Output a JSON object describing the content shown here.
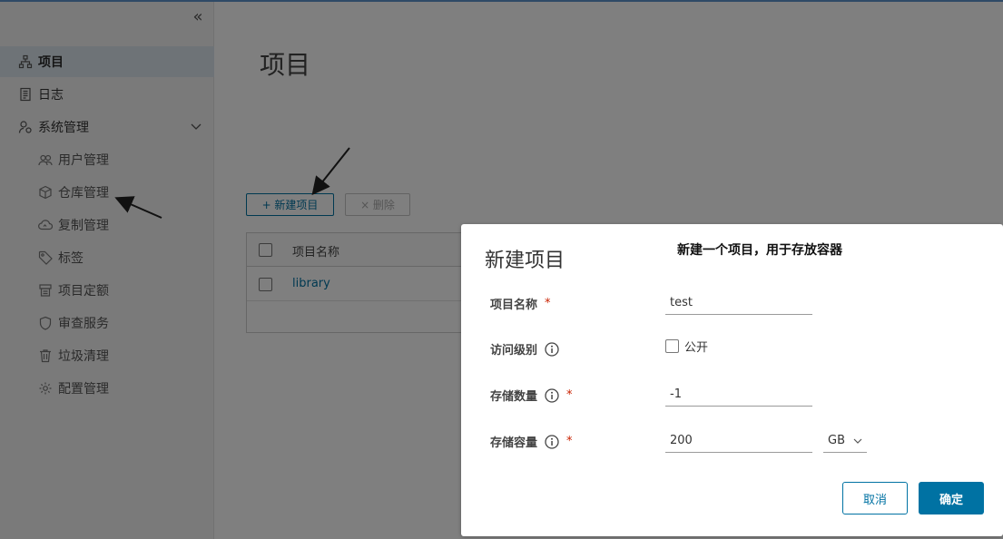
{
  "sidebar": {
    "items": [
      {
        "label": "项目",
        "icon": "projects-icon"
      },
      {
        "label": "日志",
        "icon": "logs-icon"
      },
      {
        "label": "系统管理",
        "icon": "admin-icon"
      },
      {
        "label": "用户管理",
        "icon": "users-icon"
      },
      {
        "label": "仓库管理",
        "icon": "registry-icon"
      },
      {
        "label": "复制管理",
        "icon": "replication-icon"
      },
      {
        "label": "标签",
        "icon": "tag-icon"
      },
      {
        "label": "项目定额",
        "icon": "quota-icon"
      },
      {
        "label": "审查服务",
        "icon": "shield-icon"
      },
      {
        "label": "垃圾清理",
        "icon": "trash-icon"
      },
      {
        "label": "配置管理",
        "icon": "gear-icon"
      }
    ]
  },
  "main": {
    "title": "项目",
    "new_button": "+ 新建项目",
    "delete_button": "× 删除",
    "table": {
      "header": "项目名称",
      "rows": [
        "library"
      ]
    }
  },
  "modal": {
    "title": "新建项目",
    "annotation": "新建一个项目，用于存放容器",
    "fields": {
      "name_label": "项目名称",
      "name_value": "test",
      "access_label": "访问级别",
      "public_label": "公开",
      "count_label": "存储数量",
      "count_value": "-1",
      "capacity_label": "存储容量",
      "capacity_value": "200",
      "unit_value": "GB"
    },
    "required_mark": "*",
    "cancel": "取消",
    "ok": "确定"
  },
  "colors": {
    "accent": "#0072a3",
    "required": "#c92100",
    "sidebar_active": "#dde6ee"
  }
}
